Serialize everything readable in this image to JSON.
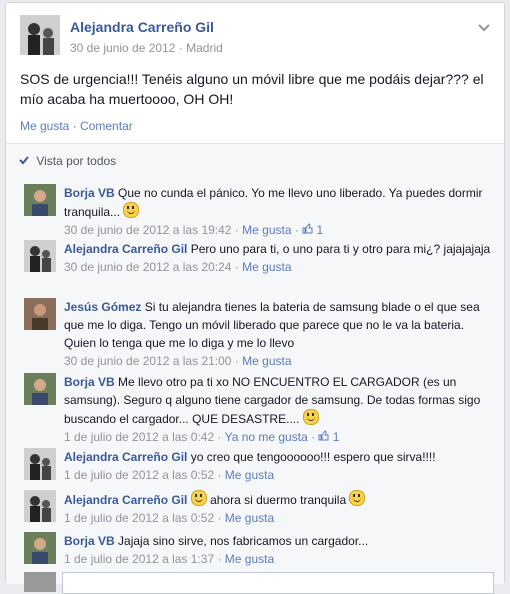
{
  "post": {
    "author": "Alejandra Carreño Gil",
    "date": "30 de junio de 2012",
    "separator": "·",
    "location": "Madrid",
    "text": "SOS de urgencia!!! Tenéis alguno un móvil libre que me podáis dejar??? el mío acaba ha muertoooo, OH OH!",
    "like_label": "Me gusta",
    "comment_label": "Comentar",
    "dot": "·"
  },
  "seen": {
    "label": "Vista por todos"
  },
  "comments": [
    {
      "author": "Borja VB",
      "text": "Que no cunda el pánico. Yo me llevo uno liberado. Ya puedes dormir tranquila...",
      "time": "30 de junio de 2012 a las 19:42",
      "like": "Me gusta",
      "likes": "1"
    },
    {
      "author": "Alejandra Carreño Gil",
      "text": "Pero uno para ti, o uno para ti y otro para mi¿? jajajajaja",
      "time": "30 de junio de 2012 a las 20:24",
      "like": "Me gusta"
    },
    {
      "author": "Jesús Gómez",
      "text": "Si tu alejandra tienes la bateria de samsung blade o el que sea que me lo diga. Tengo un móvil liberado que parece que no le va la bateria. Quien lo tenga que me lo diga y me lo llevo",
      "time": "30 de junio de 2012 a las 21:00",
      "like": "Me gusta"
    },
    {
      "author": "Borja VB",
      "text": "Me llevo otro pa ti xo NO ENCUENTRO EL CARGADOR (es un samsung). Seguro q alguno tiene cargador de samsung. De todas formas sigo buscando el cargador... QUE DESASTRE....",
      "time": "1 de julio de 2012 a las 0:42",
      "like": "Ya no me gusta",
      "likes": "1"
    },
    {
      "author": "Alejandra Carreño Gil",
      "text": "yo creo que tengoooooo!!! espero que sirva!!!!",
      "time": "1 de julio de 2012 a las 0:52",
      "like": "Me gusta"
    },
    {
      "author": "Alejandra Carreño Gil",
      "text_pre": "",
      "text": "ahora si duermo tranquila",
      "time": "1 de julio de 2012 a las 0:52",
      "like": "Me gusta"
    },
    {
      "author": "Borja VB",
      "text": "Jajaja sino sirve, nos fabricamos un cargador...",
      "time": "1 de julio de 2012 a las 1:37",
      "like": "Me gusta"
    }
  ],
  "icons": {
    "seen": "check-icon",
    "menu": "chevron-down-icon",
    "like": "thumbs-up-icon",
    "emoticon": "smiley-icon"
  }
}
